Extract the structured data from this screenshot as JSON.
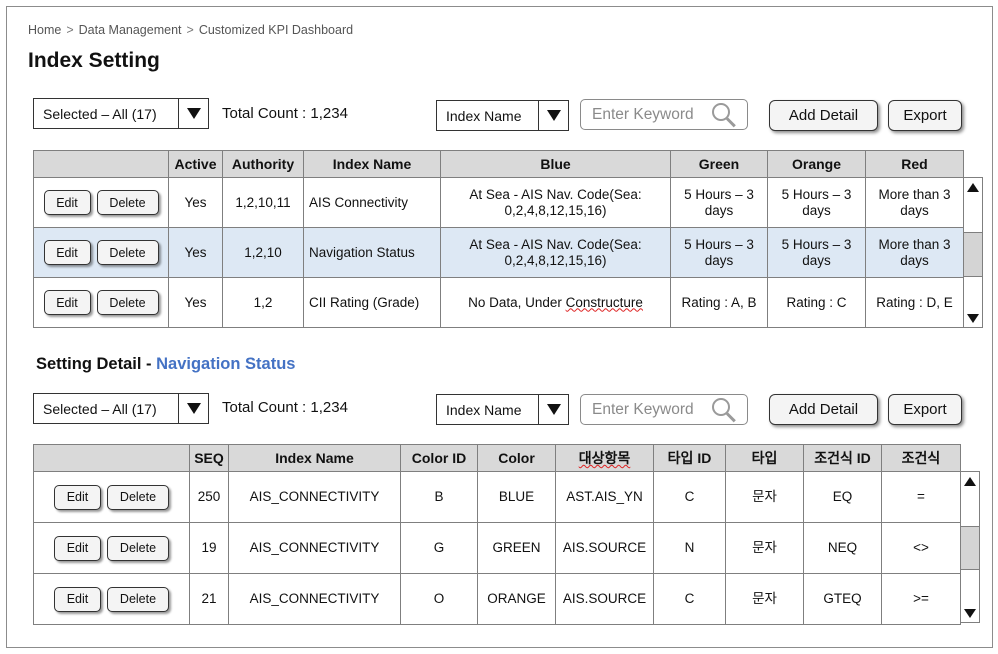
{
  "breadcrumb": [
    "Home",
    "Data Management",
    "Customized KPI Dashboard"
  ],
  "breadcrumb_separator": ">",
  "page_title": "Index Setting",
  "index_toolbar": {
    "filter_value": "Selected – All (17)",
    "total_count_label": "Total Count : 1,234",
    "search_field_value": "Index Name",
    "keyword_placeholder": "Enter Keyword",
    "add_detail_label": "Add Detail",
    "export_label": "Export"
  },
  "index_table": {
    "columns": [
      "",
      "Active",
      "Authority",
      "Index Name",
      "Blue",
      "Green",
      "Orange",
      "Red"
    ],
    "rows": [
      {
        "edit": "Edit",
        "delete": "Delete",
        "active": "Yes",
        "authority": "1,2,10,11",
        "index_name": "AIS Connectivity",
        "blue": "At Sea - AIS Nav. Code(Sea: 0,2,4,8,12,15,16)",
        "green": "5 Hours – 3 days",
        "orange": "5 Hours – 3 days",
        "red": "More than 3 days",
        "selected": false
      },
      {
        "edit": "Edit",
        "delete": "Delete",
        "active": "Yes",
        "authority": "1,2,10",
        "index_name": "Navigation Status",
        "blue": "At Sea - AIS Nav. Code(Sea: 0,2,4,8,12,15,16)",
        "green": "5 Hours – 3 days",
        "orange": "5 Hours – 3 days",
        "red": "More than 3 days",
        "selected": true
      },
      {
        "edit": "Edit",
        "delete": "Delete",
        "active": "Yes",
        "authority": "1,2",
        "index_name": "CII Rating (Grade)",
        "blue_prefix": "No Data, Under ",
        "blue_underlined": "Constructure",
        "green": "Rating : A, B",
        "orange": "Rating : C",
        "red": "Rating : D, E",
        "selected": false
      }
    ]
  },
  "detail_title": "Setting Detail",
  "detail_title_separator": "-",
  "detail_title_accent": "Navigation Status",
  "detail_toolbar": {
    "filter_value": "Selected – All (17)",
    "total_count_label": "Total Count : 1,234",
    "search_field_value": "Index Name",
    "keyword_placeholder": "Enter Keyword",
    "add_detail_label": "Add Detail",
    "export_label": "Export"
  },
  "detail_table": {
    "columns": [
      "",
      "SEQ",
      "Index Name",
      "Color ID",
      "Color",
      "대상항목",
      "타입 ID",
      "타입",
      "조건식 ID",
      "조건식"
    ],
    "rows": [
      {
        "edit": "Edit",
        "delete": "Delete",
        "seq": "250",
        "index_name": "AIS_CONNECTIVITY",
        "color_id": "B",
        "color": "BLUE",
        "target": "AST.AIS_YN",
        "type_id": "C",
        "type": "문자",
        "cond_id": "EQ",
        "cond": "="
      },
      {
        "edit": "Edit",
        "delete": "Delete",
        "seq": "19",
        "index_name": "AIS_CONNECTIVITY",
        "color_id": "G",
        "color": "GREEN",
        "target": "AIS.SOURCE",
        "type_id": "N",
        "type": "문자",
        "cond_id": "NEQ",
        "cond": "<>"
      },
      {
        "edit": "Edit",
        "delete": "Delete",
        "seq": "21",
        "index_name": "AIS_CONNECTIVITY",
        "color_id": "O",
        "color": "ORANGE",
        "target": "AIS.SOURCE",
        "type_id": "C",
        "type": "문자",
        "cond_id": "GTEQ",
        "cond": ">="
      }
    ]
  },
  "colors": {
    "accent": "#4472c4",
    "header_bg": "#d9d9d9",
    "selected_row": "#dde8f4",
    "spell_underline": "#dd2222"
  },
  "icons": {
    "search": "search-icon",
    "dropdown": "triangle-down-icon",
    "scroll_up": "triangle-up-icon",
    "scroll_down": "triangle-down-icon"
  }
}
